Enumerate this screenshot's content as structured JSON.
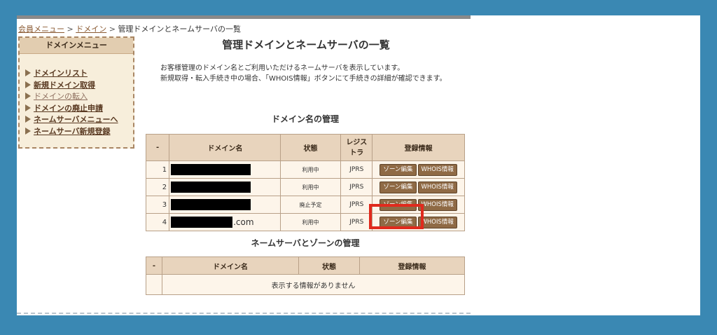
{
  "breadcrumb": {
    "member_menu": "会員メニュー",
    "sep1": " > ",
    "domain": "ドメイン",
    "sep2": " > ",
    "current": "管理ドメインとネームサーバの一覧"
  },
  "sidebar": {
    "title": "ドメインメニュー",
    "items": [
      {
        "label": "ドメインリスト"
      },
      {
        "label": "新規ドメイン取得"
      },
      {
        "label": "ドメインの転入"
      },
      {
        "label": "ドメインの廃止申請"
      },
      {
        "label": "ネームサーバメニューへ"
      },
      {
        "label": "ネームサーバ新規登録"
      }
    ]
  },
  "page": {
    "title": "管理ドメインとネームサーバの一覧",
    "desc_line1": "お客様管理のドメイン名とご利用いただけるネームサーバを表示しています。",
    "desc_line2": "新規取得・転入手続き中の場合、「WHOIS情報」ボタンにて手続きの詳細が確認できます。"
  },
  "domain_section": {
    "title": "ドメイン名の管理",
    "headers": {
      "idx": "-",
      "domain": "ドメイン名",
      "status": "状態",
      "registrar_line1": "レジス",
      "registrar_line2": "トラ",
      "info": "登録情報"
    },
    "rows": [
      {
        "idx": "1",
        "suffix": "",
        "status": "利用中",
        "registrar": "JPRS",
        "zone_btn": "ゾーン編集",
        "whois_btn": "WHOIS情報"
      },
      {
        "idx": "2",
        "suffix": "",
        "status": "利用中",
        "registrar": "JPRS",
        "zone_btn": "ゾーン編集",
        "whois_btn": "WHOIS情報"
      },
      {
        "idx": "3",
        "suffix": "",
        "status": "廃止予定",
        "registrar": "JPRS",
        "zone_btn": "ゾーン編集",
        "whois_btn": "WHOIS情報"
      },
      {
        "idx": "4",
        "suffix": ".com",
        "status": "利用中",
        "registrar": "JPRS",
        "zone_btn": "ゾーン編集",
        "whois_btn": "WHOIS情報"
      }
    ]
  },
  "ns_section": {
    "title": "ネームサーバとゾーンの管理",
    "headers": {
      "idx": "-",
      "domain": "ドメイン名",
      "status": "状態",
      "info": "登録情報"
    },
    "empty_message": "表示する情報がありません"
  },
  "colors": {
    "background": "#3a88b3",
    "highlight": "#e02a1d",
    "button": "#8f6a45"
  }
}
